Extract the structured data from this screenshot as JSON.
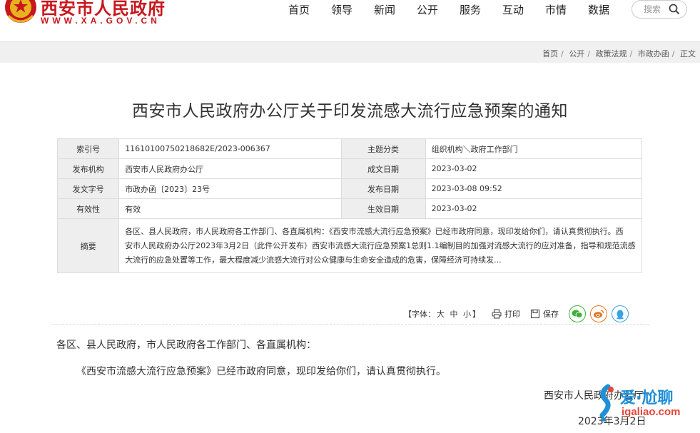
{
  "header": {
    "site_name": "西安市人民政府",
    "site_url": "WWW.XA.GOV.CN",
    "nav": [
      "首页",
      "领导",
      "新闻",
      "公开",
      "服务",
      "互动",
      "市情",
      "数据"
    ],
    "search_placeholder": "搜索"
  },
  "breadcrumb": [
    "首页",
    "公开",
    "政策法规",
    "市政办函",
    "正文"
  ],
  "article": {
    "title": "西安市人民政府办公厅关于印发流感大流行应急预案的通知",
    "info": {
      "index_label": "索引号",
      "index_value": "11610100750218682E/2023-006367",
      "topic_label": "主题分类",
      "topic_value": "组织机构＼政府工作部门",
      "publisher_label": "发布机构",
      "publisher_value": "西安市人民政府办公厅",
      "created_label": "成文日期",
      "created_value": "2023-03-02",
      "docno_label": "发文字号",
      "docno_value": "市政办函〔2023〕23号",
      "published_label": "发布日期",
      "published_value": "2023-03-08 09:52",
      "validity_label": "有效性",
      "validity_value": "有效",
      "effective_label": "生效日期",
      "effective_value": "2023-03-02",
      "summary_label": "摘要",
      "summary_line1": "各区、县人民政府，市人民政府各工作部门、各直属机构：《西安市流感大流行应急预案》已经市政府同意，现印发给你们，请认真贯彻执行。西",
      "summary_line2": "安市人民政府办公厅2023年3月2日（此件公开发布）西安市流感大流行应急预案1总则1.1编制目的加强对流感大流行的应对准备，指导和规范流感",
      "summary_line3": "大流行的应急处置等工作，最大程度减少流感大流行对公众健康与生命安全造成的危害，保障经济可持续发..."
    },
    "tools": {
      "font_prefix": "【字体：",
      "font_large": "大",
      "font_medium": "中",
      "font_small": "小",
      "font_suffix": "】",
      "print": "打印",
      "save": "保存"
    },
    "body": {
      "salutation": "各区、县人民政府，市人民政府各工作部门、各直属机构：",
      "paragraph1": "《西安市流感大流行应急预案》已经市政府同意，现印发给你们，请认真贯彻执行。",
      "signature": "西安市人民政府办公厅",
      "date": "2023年3月2日"
    }
  },
  "watermark": {
    "brand": "爱·尬聊",
    "url": "igaliao.com"
  },
  "colors": {
    "brand_red": "#c8161d",
    "wechat_green": "#3cb035",
    "weibo_orange": "#e8751a",
    "qq_blue": "#3aa3e3"
  }
}
